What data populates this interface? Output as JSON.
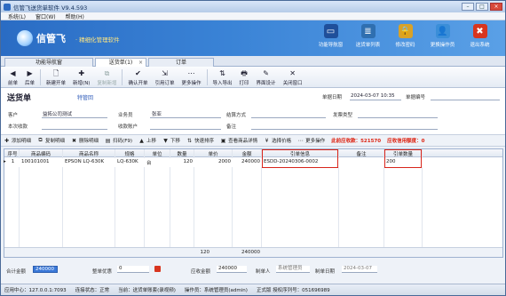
{
  "window": {
    "title": "信管飞送货单软件 V9.4.593",
    "min": "–",
    "max": "□",
    "close": "×"
  },
  "menu": [
    "系统(L)",
    "窗口(W)",
    "帮助(H)"
  ],
  "banner": {
    "brand": "信管飞",
    "slogan": "· 精细化管理软件",
    "buttons": [
      {
        "label": "功能导航窗",
        "icon": "monitor-icon",
        "color": "#1f4f9a",
        "glyph": "▭"
      },
      {
        "label": "送货单列表",
        "icon": "list-icon",
        "color": "#2f6fb0",
        "glyph": "≣"
      },
      {
        "label": "修改密码",
        "icon": "lock-icon",
        "color": "#d9a227",
        "glyph": "🔒"
      },
      {
        "label": "更换操作员",
        "icon": "user-icon",
        "color": "#3b8ed8",
        "glyph": "👤"
      },
      {
        "label": "退出系统",
        "icon": "exit-icon",
        "color": "#d8351f",
        "glyph": "✖"
      }
    ]
  },
  "tabs": [
    {
      "label": "功能导航窗",
      "active": false
    },
    {
      "label": "送货单(1)",
      "active": true,
      "close": "×"
    },
    {
      "label": "订单",
      "active": false
    }
  ],
  "toolbar": [
    {
      "label": "前单",
      "icon": "prev-icon",
      "glyph": "◀",
      "enabled": true
    },
    {
      "label": "后单",
      "icon": "next-icon",
      "glyph": "▶",
      "enabled": true
    },
    {
      "sep": true
    },
    {
      "label": "新建开单",
      "icon": "new-doc-icon",
      "glyph": "🗋",
      "enabled": true
    },
    {
      "label": "新增(N)",
      "icon": "add-icon",
      "glyph": "✚",
      "enabled": true
    },
    {
      "label": "复制新增",
      "icon": "copy-icon",
      "glyph": "⧉",
      "enabled": false
    },
    {
      "sep": true
    },
    {
      "label": "确认开单",
      "icon": "confirm-icon",
      "glyph": "✔",
      "enabled": true
    },
    {
      "label": "引用订单",
      "icon": "reference-icon",
      "glyph": "⇲",
      "enabled": true
    },
    {
      "label": "更多操作",
      "icon": "more-icon",
      "glyph": "⋯",
      "enabled": true
    },
    {
      "sep": true
    },
    {
      "label": "导入导出",
      "icon": "import-export-icon",
      "glyph": "⇅",
      "enabled": true
    },
    {
      "label": "打印",
      "icon": "print-icon",
      "glyph": "🖶",
      "enabled": true
    },
    {
      "label": "界面设计",
      "icon": "design-icon",
      "glyph": "✎",
      "enabled": true
    },
    {
      "label": "关闭窗口",
      "icon": "close-window-icon",
      "glyph": "✕",
      "enabled": true
    }
  ],
  "doc": {
    "title": "送货单",
    "subtitle": "特管回",
    "date_label": "单据日期",
    "date_value": "2024-03-07 10:35",
    "number_label": "单据编号",
    "number_value": "",
    "customer_label": "客户",
    "customer_value": "益拓公司测试",
    "salesman_label": "业务员",
    "salesman_value": "张亚",
    "settle_label": "结算方式",
    "settle_value": "",
    "invoice_label": "发票类型",
    "invoice_value": "",
    "receipt_label": "本次收款",
    "receipt_value": "",
    "account_label": "收款账户",
    "account_value": "",
    "remark_label": "备注",
    "remark_value": ""
  },
  "gridbar": {
    "buttons": [
      {
        "label": "添加明细",
        "icon": "add-row-icon",
        "glyph": "✚"
      },
      {
        "label": "复制明细",
        "icon": "copy-row-icon",
        "glyph": "⧉"
      },
      {
        "label": "删除明细",
        "icon": "delete-row-icon",
        "glyph": "✖"
      },
      {
        "label": "扫码(F9)",
        "icon": "scan-icon",
        "glyph": "▤"
      },
      {
        "label": "上移",
        "icon": "up-icon",
        "glyph": "▲"
      },
      {
        "label": "下移",
        "icon": "down-icon",
        "glyph": "▼"
      },
      {
        "label": "快速排序",
        "icon": "sort-icon",
        "glyph": "⇅"
      },
      {
        "label": "查看商品详情",
        "icon": "detail-icon",
        "glyph": "▣"
      },
      {
        "label": "选择价格",
        "icon": "price-icon",
        "glyph": "¥"
      },
      {
        "label": "更多操作",
        "icon": "more-ops-icon",
        "glyph": "⋯"
      }
    ],
    "receivable": "此前应收款：521570",
    "credit": "应收信用额度：0"
  },
  "table": {
    "columns": [
      "序号",
      "商品编码",
      "商品名称",
      "规格",
      "单位",
      "数量",
      "单价",
      "金额",
      "引单信息",
      "备注",
      "引单数量"
    ],
    "rows": [
      {
        "marker": "▸",
        "cells": [
          "1",
          "100101001",
          "EPSON LQ-630K",
          "LQ-630K",
          "台",
          "120",
          "2000",
          "240000",
          "ESDD-20240306-0002",
          "",
          "200"
        ]
      }
    ],
    "summary": {
      "qty": "120",
      "amount": "240000"
    }
  },
  "footer": {
    "total_label": "合计金额",
    "total_value": "240000",
    "discount_label": "整单优惠",
    "discount_value": "0",
    "due_label": "应收金额",
    "due_value": "240000",
    "maker_label": "制单人",
    "maker_value": "系统管理员",
    "make_date_label": "制单日期",
    "make_date_value": "2024-03-07"
  },
  "status": [
    "应用中心：127.0.0.1:7093",
    "连接状态：正常",
    "当前：送货单账套(录视频)",
    "操作员：系统管理员(admin)",
    "正式版 授权序列号：051696989"
  ]
}
